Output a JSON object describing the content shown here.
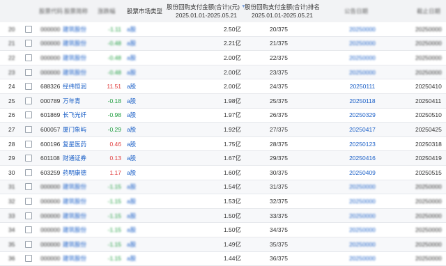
{
  "header": {
    "col_idx": "",
    "col_code": "股票代码",
    "col_name": "股票简称",
    "col_change": "涨跌幅",
    "col_market": "股票市场类型",
    "col_amount_line1": "股份回购支付金额(合计)(元)",
    "col_amount_line2": "2025.01.01-2025.05.21",
    "col_rank_line1": "股份回购支付金额(合计)排名",
    "col_rank_line2": "2025.01.01-2025.05.21",
    "col_date1": "公告日期",
    "col_date2": "截止日期"
  },
  "rows": [
    {
      "idx": "20",
      "code": "000000",
      "name": "建筑股份",
      "change": "-1.11",
      "market": "a股",
      "amount": "2.50亿",
      "rank": "20/375",
      "date1": "20250000",
      "date2": "20250000"
    },
    {
      "idx": "21",
      "code": "000000",
      "name": "建筑股份",
      "change": "-0.48",
      "market": "a股",
      "amount": "2.21亿",
      "rank": "21/375",
      "date1": "20250000",
      "date2": "20250000"
    },
    {
      "idx": "22",
      "code": "000000",
      "name": "建筑股份",
      "change": "-0.48",
      "market": "a股",
      "amount": "2.00亿",
      "rank": "22/375",
      "date1": "20250000",
      "date2": "20250000"
    },
    {
      "idx": "23",
      "code": "000000",
      "name": "建筑股份",
      "change": "-0.48",
      "market": "a股",
      "amount": "2.00亿",
      "rank": "23/375",
      "date1": "20250000",
      "date2": "20250000"
    },
    {
      "idx": "24",
      "code": "688326",
      "name": "经纬恒润",
      "change": "11.51",
      "market": "a股",
      "amount": "2.00亿",
      "rank": "24/375",
      "date1": "20250111",
      "date2": "20250410"
    },
    {
      "idx": "25",
      "code": "000789",
      "name": "万年青",
      "change": "-0.18",
      "market": "a股",
      "amount": "1.98亿",
      "rank": "25/375",
      "date1": "20250118",
      "date2": "20250411"
    },
    {
      "idx": "26",
      "code": "601869",
      "name": "长飞光纤",
      "change": "-0.98",
      "market": "a股",
      "amount": "1.97亿",
      "rank": "26/375",
      "date1": "20250329",
      "date2": "20250510"
    },
    {
      "idx": "27",
      "code": "600057",
      "name": "厦门象屿",
      "change": "-0.29",
      "market": "a股",
      "amount": "1.92亿",
      "rank": "27/375",
      "date1": "20250417",
      "date2": "20250425"
    },
    {
      "idx": "28",
      "code": "600196",
      "name": "复星医药",
      "change": "0.46",
      "market": "a股",
      "amount": "1.75亿",
      "rank": "28/375",
      "date1": "20250123",
      "date2": "20250318"
    },
    {
      "idx": "29",
      "code": "601108",
      "name": "财通证券",
      "change": "0.13",
      "market": "a股",
      "amount": "1.67亿",
      "rank": "29/375",
      "date1": "20250416",
      "date2": "20250419"
    },
    {
      "idx": "30",
      "code": "603259",
      "name": "药明康德",
      "change": "1.17",
      "market": "a股",
      "amount": "1.60亿",
      "rank": "30/375",
      "date1": "20250409",
      "date2": "20250515"
    },
    {
      "idx": "31",
      "code": "000000",
      "name": "建筑股份",
      "change": "-1.15",
      "market": "a股",
      "amount": "1.54亿",
      "rank": "31/375",
      "date1": "20250000",
      "date2": "20250000"
    },
    {
      "idx": "32",
      "code": "000000",
      "name": "建筑股份",
      "change": "-1.15",
      "market": "a股",
      "amount": "1.53亿",
      "rank": "32/375",
      "date1": "20250000",
      "date2": "20250000"
    },
    {
      "idx": "33",
      "code": "000000",
      "name": "建筑股份",
      "change": "-1.15",
      "market": "a股",
      "amount": "1.50亿",
      "rank": "33/375",
      "date1": "20250000",
      "date2": "20250000"
    },
    {
      "idx": "34",
      "code": "000000",
      "name": "建筑股份",
      "change": "-1.15",
      "market": "a股",
      "amount": "1.50亿",
      "rank": "34/375",
      "date1": "20250000",
      "date2": "20250000"
    },
    {
      "idx": "35",
      "code": "000000",
      "name": "建筑股份",
      "change": "-1.15",
      "market": "a股",
      "amount": "1.49亿",
      "rank": "35/375",
      "date1": "20250000",
      "date2": "20250000"
    },
    {
      "idx": "36",
      "code": "000000",
      "name": "建筑股份",
      "change": "-1.15",
      "market": "a股",
      "amount": "1.44亿",
      "rank": "36/375",
      "date1": "20250000",
      "date2": "20250000"
    }
  ],
  "blurred_rows": [
    0,
    1,
    2,
    3,
    11,
    12,
    13,
    14,
    15,
    16
  ],
  "colors": {
    "up": "#e03a3a",
    "down": "#1a9b3b",
    "link": "#1a5fc7",
    "header_bg": "#f2f3f5"
  }
}
